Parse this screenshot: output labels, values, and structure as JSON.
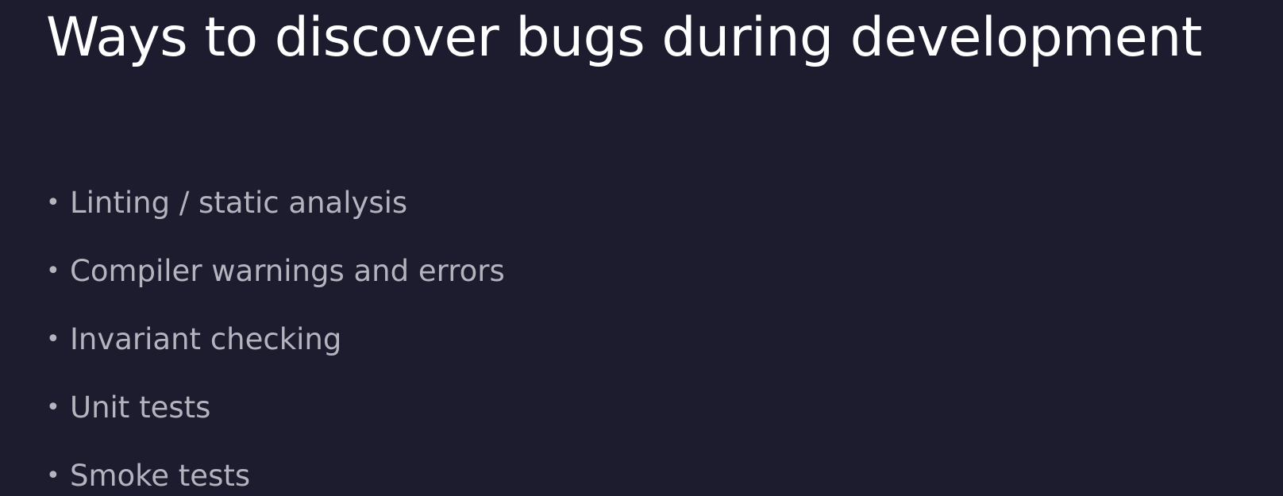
{
  "slide": {
    "title": "Ways to discover bugs during development",
    "bullets": [
      "Linting / static analysis",
      "Compiler warnings and errors",
      "Invariant checking",
      "Unit tests",
      "Smoke tests"
    ],
    "bullet_glyph": "•"
  },
  "colors": {
    "background": "#1c1c2e",
    "title": "#ffffff",
    "bullet_text": "#b4b4bf"
  }
}
